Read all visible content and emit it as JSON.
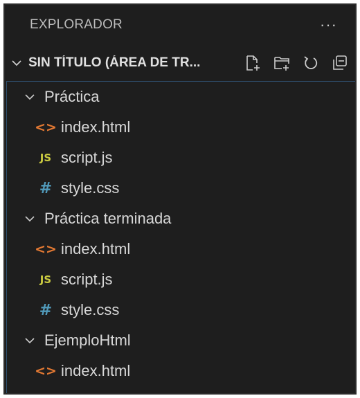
{
  "explorer": {
    "title": "EXPLORADOR",
    "more_icon": "more-actions-icon",
    "more_glyph": "···"
  },
  "workspace": {
    "title": "SIN TÍTULO (ÁREA DE TR...",
    "expanded": true,
    "actions": [
      "new-file-icon",
      "new-folder-icon",
      "refresh-icon",
      "collapse-all-icon"
    ]
  },
  "tree": {
    "folders": [
      {
        "name": "Práctica",
        "expanded": true,
        "files": [
          {
            "name": "index.html",
            "icon": "html-file-icon",
            "glyph": "<>"
          },
          {
            "name": "script.js",
            "icon": "js-file-icon",
            "glyph": "JS"
          },
          {
            "name": "style.css",
            "icon": "css-file-icon",
            "glyph": "#"
          }
        ]
      },
      {
        "name": "Práctica terminada",
        "expanded": true,
        "files": [
          {
            "name": "index.html",
            "icon": "html-file-icon",
            "glyph": "<>"
          },
          {
            "name": "script.js",
            "icon": "js-file-icon",
            "glyph": "JS"
          },
          {
            "name": "style.css",
            "icon": "css-file-icon",
            "glyph": "#"
          }
        ]
      },
      {
        "name": "EjemploHtml",
        "expanded": true,
        "files": [
          {
            "name": "index.html",
            "icon": "html-file-icon",
            "glyph": "<>"
          }
        ]
      }
    ]
  },
  "colors": {
    "background": "#1e1e1e",
    "text": "#cccccc",
    "html_icon": "#e37933",
    "js_icon": "#cbcb41",
    "css_icon": "#519aba",
    "focus_border": "#2f4f6f"
  }
}
